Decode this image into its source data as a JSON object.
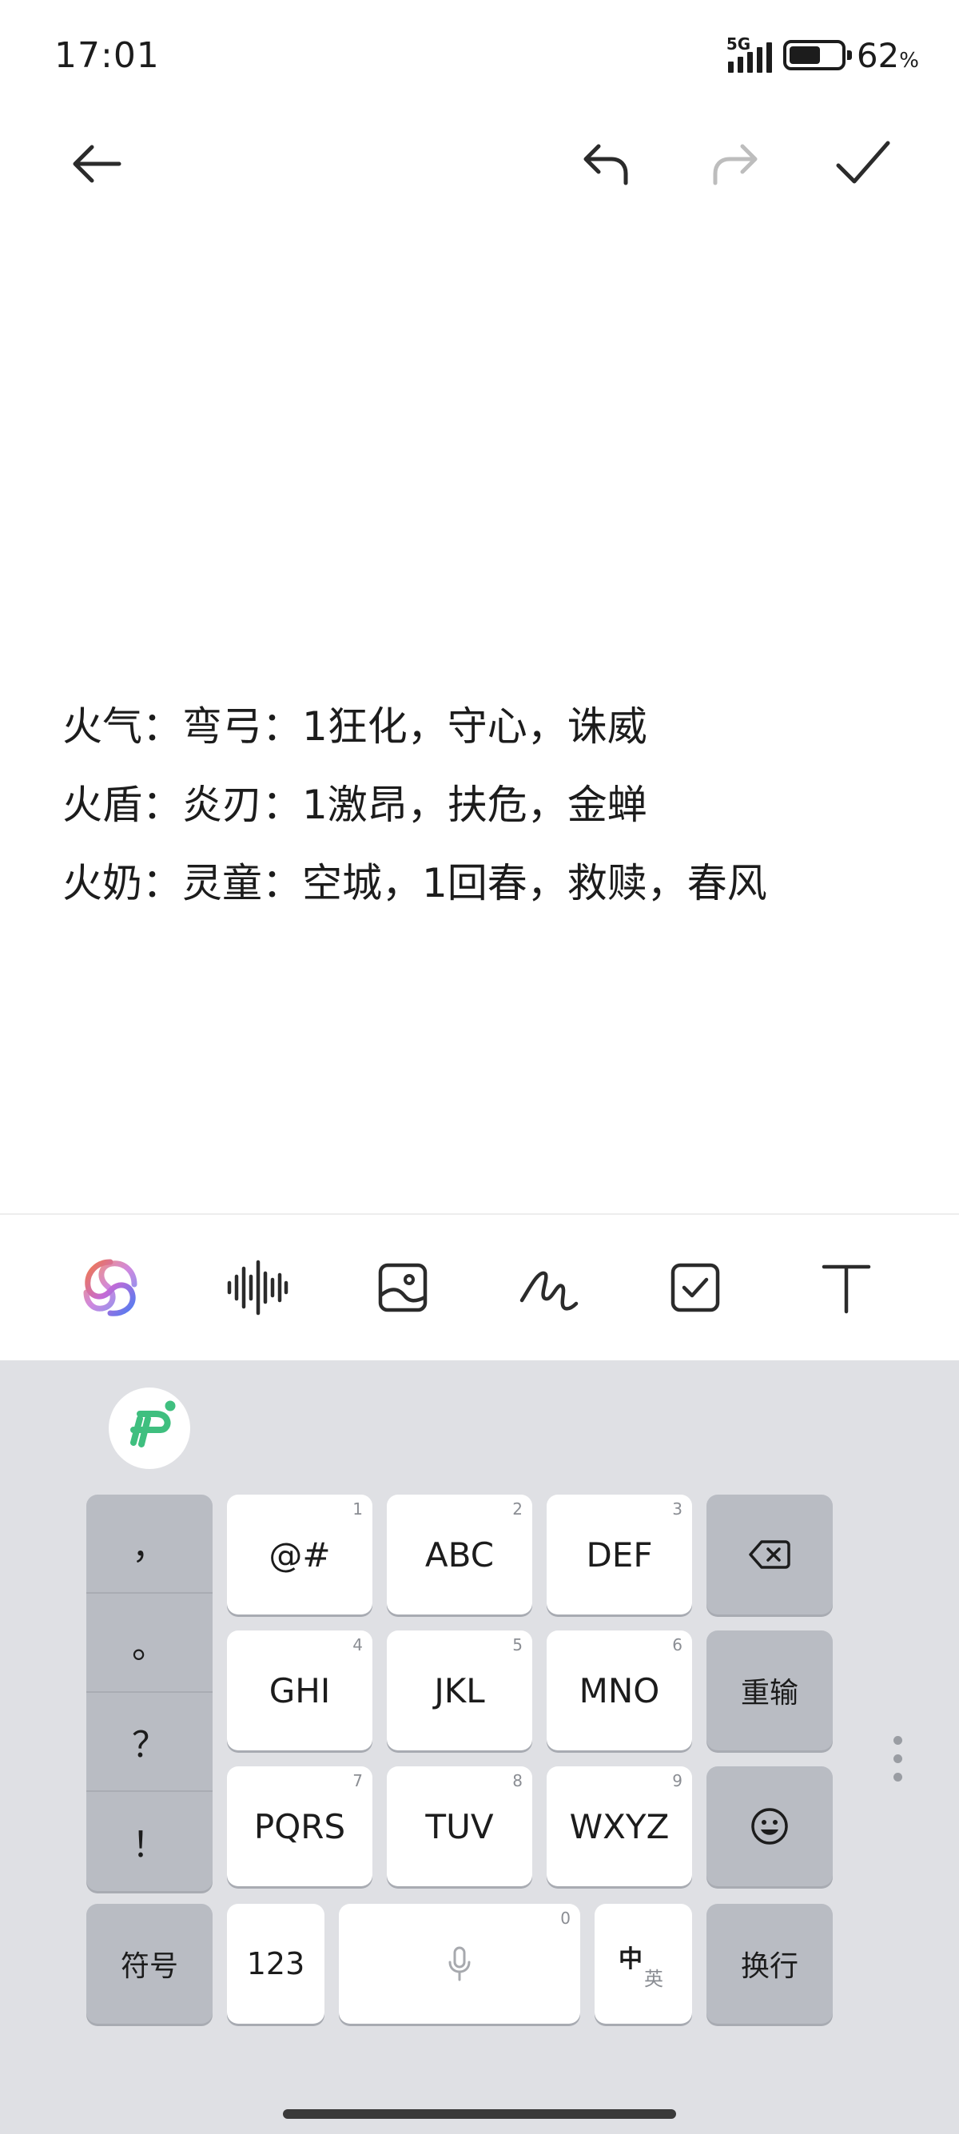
{
  "status_bar": {
    "time": "17:01",
    "network": "5G",
    "battery_percent": "62",
    "battery_unit": "%",
    "battery_level": 0.62
  },
  "toolbar": {
    "back_icon": "arrow-left-icon",
    "undo_icon": "undo-icon",
    "redo_icon": "redo-icon",
    "done_icon": "check-icon"
  },
  "note": {
    "lines": [
      "火气：弯弓：1狂化，守心，诛威",
      "火盾：炎刃：1激昂，扶危，金蝉",
      "火奶：灵童：空城，1回春，救赎，春风"
    ]
  },
  "edit_tools": [
    {
      "icon": "ai-assistant-icon"
    },
    {
      "icon": "voice-waveform-icon"
    },
    {
      "icon": "image-icon"
    },
    {
      "icon": "handwriting-icon"
    },
    {
      "icon": "checklist-icon"
    },
    {
      "icon": "text-format-icon"
    }
  ],
  "keyboard": {
    "logo_icon": "input-method-logo-icon",
    "punctuation": [
      "，",
      "。",
      "？",
      "！"
    ],
    "keys": [
      {
        "label": "@#",
        "num": "1"
      },
      {
        "label": "ABC",
        "num": "2"
      },
      {
        "label": "DEF",
        "num": "3"
      },
      {
        "label": "GHI",
        "num": "4"
      },
      {
        "label": "JKL",
        "num": "5"
      },
      {
        "label": "MNO",
        "num": "6"
      },
      {
        "label": "PQRS",
        "num": "7"
      },
      {
        "label": "TUV",
        "num": "8"
      },
      {
        "label": "WXYZ",
        "num": "9"
      }
    ],
    "backspace_icon": "backspace-icon",
    "retype_label": "重输",
    "emoji_icon": "emoji-icon",
    "symbols_label": "符号",
    "numbers_label": "123",
    "space_num": "0",
    "space_icon": "microphone-icon",
    "lang_switch_zh": "中",
    "lang_switch_en": "英",
    "enter_label": "换行",
    "colors": {
      "keyboard_bg": "#dfe0e4",
      "light_key": "#ffffff",
      "dark_key": "#b9bcc3",
      "logo_green": "#3fbf7f"
    }
  }
}
